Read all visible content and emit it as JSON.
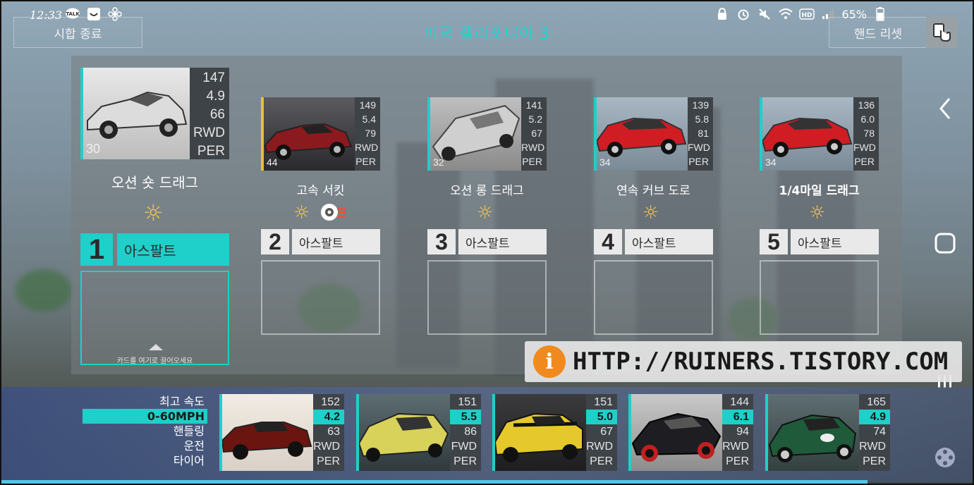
{
  "status_bar": {
    "time": "12:33",
    "battery": "65%"
  },
  "header": {
    "exit_label": "시합 종료",
    "title": "미국 캘리포니아 3",
    "reset_label": "핸드 리셋"
  },
  "races": [
    {
      "number": "1",
      "name": "오션 숏 드래그",
      "surface": "아스팔트",
      "card": {
        "stats": [
          "147",
          "4.9",
          "66",
          "RWD",
          "PER"
        ],
        "rating": "30",
        "accent": "#1fcfc9",
        "paint": "#dcdcdc"
      }
    },
    {
      "number": "2",
      "name": "고속 서킷",
      "surface": "아스팔트",
      "card": {
        "stats": [
          "149",
          "5.4",
          "79",
          "RWD",
          "PER"
        ],
        "rating": "44",
        "accent": "#e3c236",
        "paint": "#8b1a1e"
      }
    },
    {
      "number": "3",
      "name": "오션 롱 드래그",
      "surface": "아스팔트",
      "card": {
        "stats": [
          "141",
          "5.2",
          "67",
          "RWD",
          "PER"
        ],
        "rating": "32",
        "accent": "#1fcfc9",
        "paint": "#cfcfcf"
      }
    },
    {
      "number": "4",
      "name": "연속 커브 도로",
      "surface": "아스팔트",
      "card": {
        "stats": [
          "139",
          "5.8",
          "81",
          "FWD",
          "PER"
        ],
        "rating": "34",
        "accent": "#1fcfc9",
        "paint": "#d01d24"
      }
    },
    {
      "number": "5",
      "name": "1/4마일 드래그",
      "surface": "아스팔트",
      "card": {
        "stats": [
          "136",
          "6.0",
          "78",
          "FWD",
          "PER"
        ],
        "rating": "34",
        "accent": "#1fcfc9",
        "paint": "#d01d24"
      }
    }
  ],
  "drop_hint": "카드를 여기로 끌어오세요",
  "sort": {
    "options": [
      "최고 속도",
      "0-60MPH",
      "핸들링",
      "운전",
      "타이어"
    ],
    "selected": "0-60MPH"
  },
  "hand": [
    {
      "stats": [
        "152",
        "4.2",
        "63",
        "RWD",
        "PER"
      ],
      "paint": "#6b1510",
      "accent": "#1fcfc9"
    },
    {
      "stats": [
        "151",
        "5.5",
        "86",
        "FWD",
        "PER"
      ],
      "paint": "#d8d25a",
      "accent": "#1fcfc9"
    },
    {
      "stats": [
        "151",
        "5.0",
        "67",
        "RWD",
        "PER"
      ],
      "paint": "#e5c92c",
      "accent": "#1fcfc9"
    },
    {
      "stats": [
        "144",
        "6.1",
        "94",
        "RWD",
        "PER"
      ],
      "paint": "#1e1e22",
      "accent": "#1fcfc9"
    },
    {
      "stats": [
        "165",
        "4.9",
        "74",
        "RWD",
        "PER"
      ],
      "paint": "#1f5a3a",
      "accent": "#1fcfc9"
    }
  ],
  "watermark": "HTTP://RUINERS.TISTORY.COM"
}
